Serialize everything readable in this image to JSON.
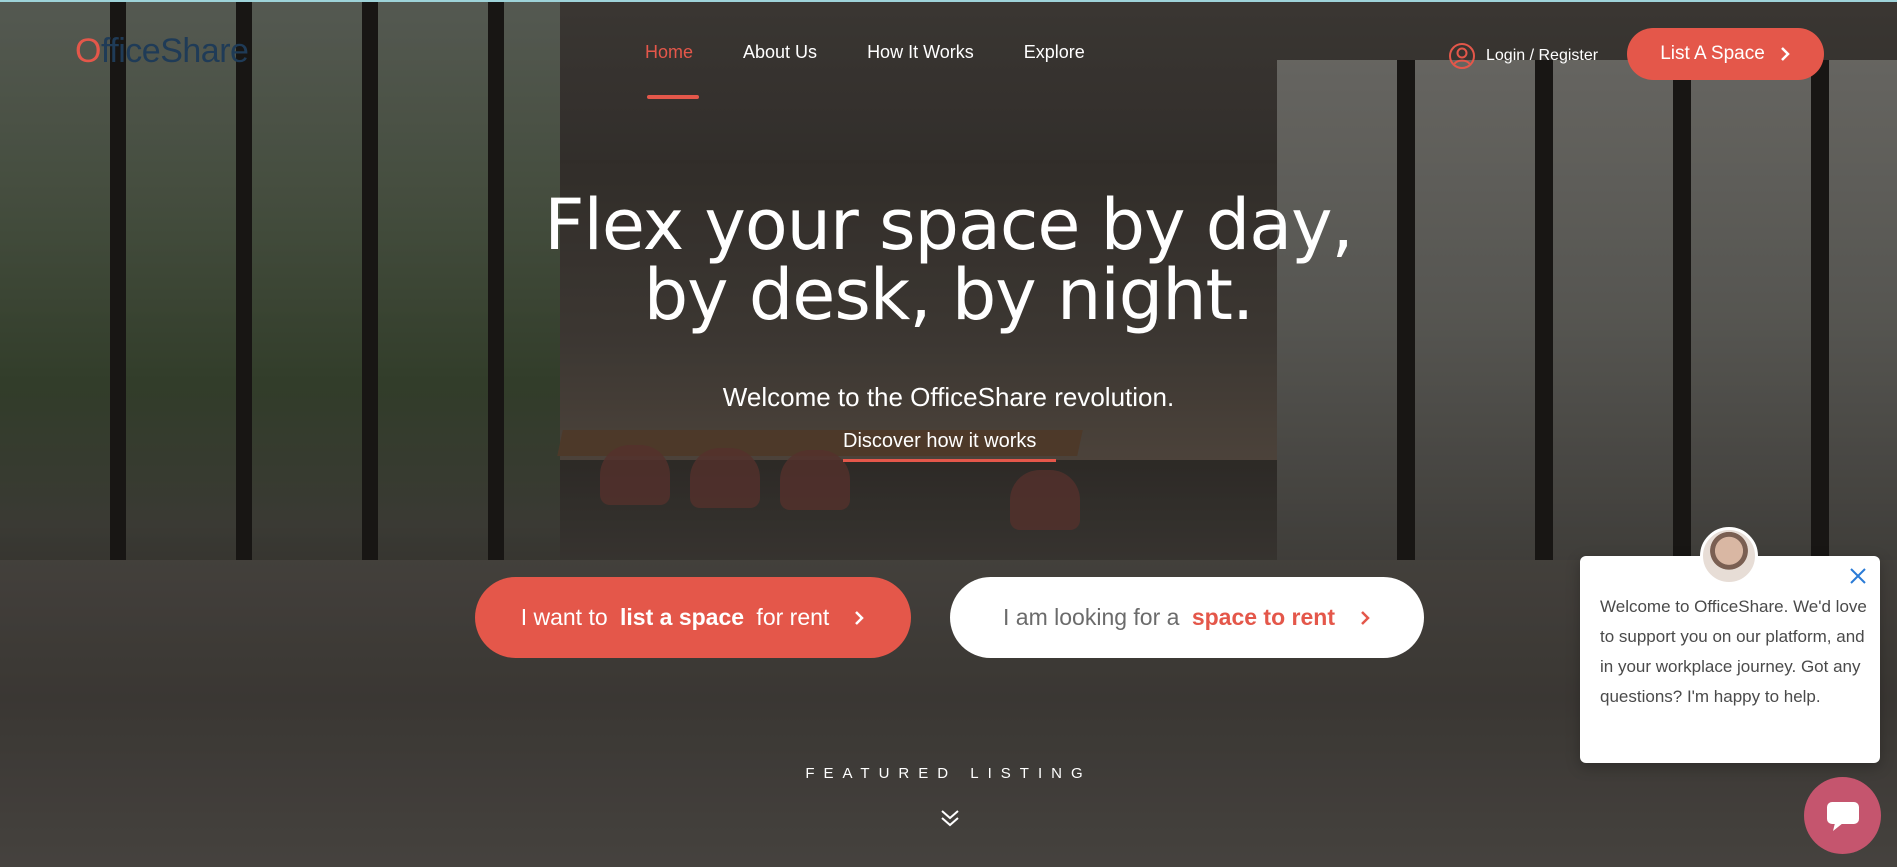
{
  "header": {
    "logo": {
      "first_letter": "O",
      "rest": "fficeShare"
    },
    "nav": [
      {
        "label": "Home",
        "active": true
      },
      {
        "label": "About Us",
        "active": false
      },
      {
        "label": "How It Works",
        "active": false
      },
      {
        "label": "Explore",
        "active": false
      }
    ],
    "login_label": "Login / Register",
    "list_space_label": "List A Space"
  },
  "hero": {
    "headline_line1": "Flex your space by day,",
    "headline_line2": "by desk, by night.",
    "subline": "Welcome to the OfficeShare revolution.",
    "discover_link": "Discover how it works",
    "cta_list": {
      "prefix": "I want to ",
      "bold": "list a space",
      "suffix": " for rent"
    },
    "cta_rent": {
      "prefix": "I am looking for a ",
      "bold": "space to rent"
    }
  },
  "featured_label": "FEATURED LISTING",
  "chat": {
    "message": "Welcome to OfficeShare. We'd love to support you on our platform, and in your workplace journey. Got any questions? I'm happy to help."
  },
  "colors": {
    "accent": "#e4574a",
    "logo_dark": "#1f3b57",
    "chat_launcher": "#c5556e"
  },
  "icons": [
    "user-icon",
    "chevron-right-icon",
    "double-chevron-down-icon",
    "close-icon",
    "chat-icon"
  ]
}
